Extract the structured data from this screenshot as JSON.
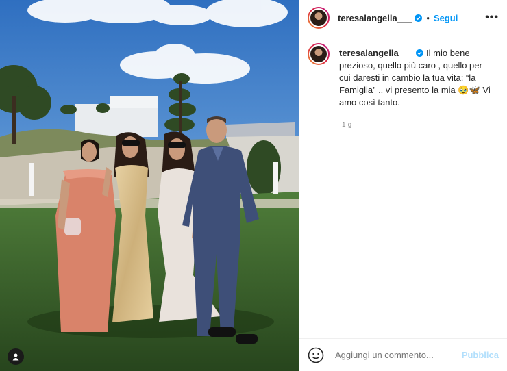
{
  "post": {
    "username": "teresalangella___",
    "follow_label": "Segui",
    "dot": "•",
    "more_label": "•••",
    "caption": "Il mio bene prezioso, quello più caro , quello per cui daresti in cambio la tua vita: “la Famiglia” .. vi presento la mia 🥹🦋 Vi amo così tanto.",
    "time": "1 g"
  },
  "comment": {
    "placeholder": "Aggiungi un commento...",
    "publish_label": "Pubblica"
  },
  "icons": {
    "verified": "verified-badge-icon",
    "emoji": "smile-icon",
    "tag": "user-tag-icon",
    "more": "more-options-icon"
  },
  "colors": {
    "accent": "#0095f6",
    "publish_disabled": "#b2dffc",
    "muted": "#8e8e8e"
  }
}
